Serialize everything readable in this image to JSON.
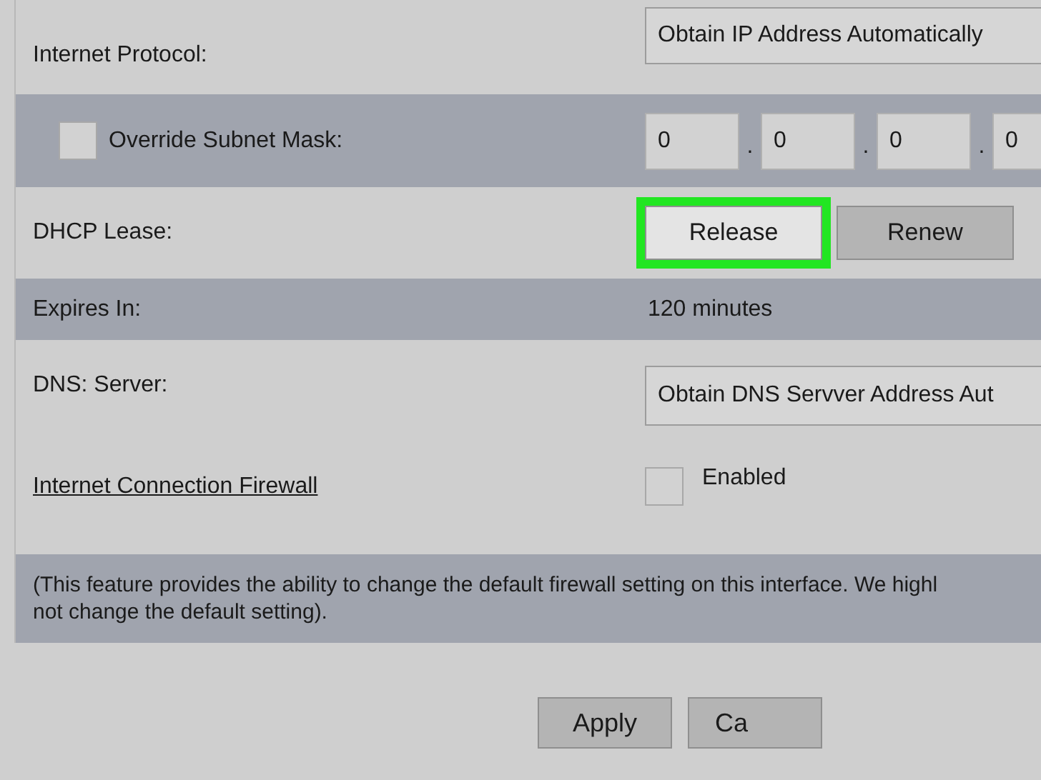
{
  "rows": [
    {
      "kind": "select",
      "label": "Internet Protocol:",
      "value": "Obtain IP Address Automatically"
    },
    {
      "kind": "subnet",
      "label": "Override Subnet Mask:",
      "checked": false,
      "octets": [
        "0",
        "0",
        "0",
        "0"
      ],
      "separator": "."
    },
    {
      "kind": "buttons",
      "label": "DHCP Lease:",
      "buttons": [
        {
          "label": "Release",
          "selected": true
        },
        {
          "label": "Renew",
          "selected": false
        }
      ]
    },
    {
      "kind": "text",
      "label": "Expires In:",
      "value": "120 minutes"
    },
    {
      "kind": "dns",
      "label": "DNS: Server:",
      "value": "Obtain DNS Servver Address Aut",
      "link": "Internet Connection Firewall",
      "checked": false,
      "check_label": "Enabled"
    },
    {
      "kind": "note",
      "lines": [
        "(This feature provides the ability to change the default firewall setting on this interface. We highl",
        "not change the default setting)."
      ]
    }
  ],
  "buttons": [
    "Apply",
    "Ca"
  ]
}
